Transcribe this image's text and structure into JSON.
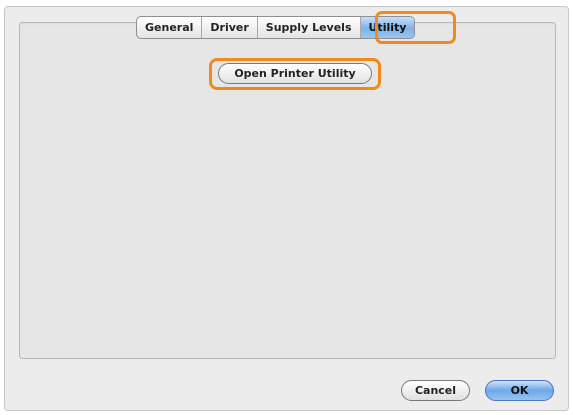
{
  "tabs": [
    {
      "label": "General",
      "selected": false
    },
    {
      "label": "Driver",
      "selected": false
    },
    {
      "label": "Supply Levels",
      "selected": false
    },
    {
      "label": "Utility",
      "selected": true
    }
  ],
  "utility_panel": {
    "open_utility_label": "Open Printer Utility"
  },
  "footer": {
    "cancel_label": "Cancel",
    "ok_label": "OK"
  },
  "colors": {
    "highlight": "#f08a1c",
    "selected_tab": "#7fb1ea",
    "default_button": "#6ea7e8"
  }
}
